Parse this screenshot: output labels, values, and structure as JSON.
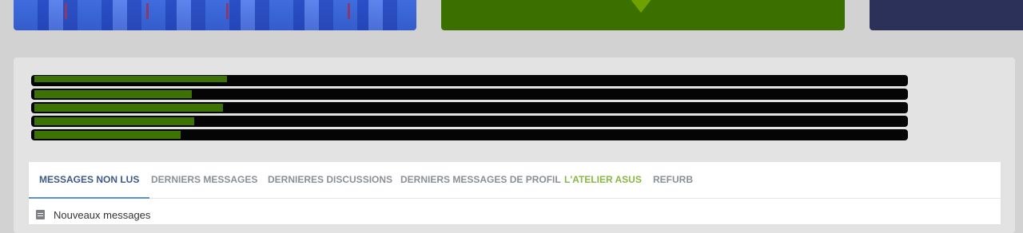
{
  "colors": {
    "page_background": "#d2d2d2",
    "panel_background": "#e4e3e3",
    "bar_track": "#050505",
    "bar_fill": "#3d7305",
    "tab_active": "#3b5a87",
    "tab_active_underline": "#5a8fd0",
    "tab_inactive": "#8a8f98",
    "tab_highlight": "#87b843"
  },
  "banner_cards": [
    {
      "name": "team-banner",
      "color": "#3a63d8"
    },
    {
      "name": "green-banner",
      "color": "#3b7000"
    },
    {
      "name": "navy-banner",
      "color": "#2c3159"
    }
  ],
  "progress_bars": [
    {
      "fraction": 0.22
    },
    {
      "fraction": 0.18
    },
    {
      "fraction": 0.215
    },
    {
      "fraction": 0.182
    },
    {
      "fraction": 0.167
    }
  ],
  "tabs": [
    {
      "label": "MESSAGES NON LUS",
      "active": true
    },
    {
      "label": "DERNIERS MESSAGES",
      "active": false
    },
    {
      "label": "DERNIERES DISCUSSIONS",
      "active": false
    },
    {
      "label": "DERNIERS MESSAGES DE PROFIL",
      "active": false
    },
    {
      "label": "L'ATELIER ASUS",
      "active": false,
      "highlight": true
    },
    {
      "label": "REFURB",
      "active": false
    }
  ],
  "section": {
    "icon": "document-icon",
    "title": "Nouveaux messages"
  }
}
